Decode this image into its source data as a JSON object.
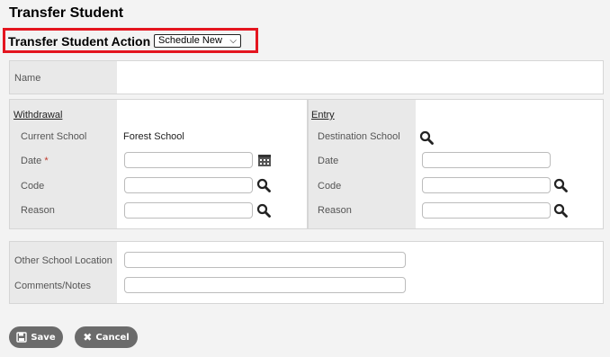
{
  "page": {
    "title": "Transfer Student"
  },
  "action": {
    "label": "Transfer Student Action :",
    "selected": "Schedule New"
  },
  "name_section": {
    "label": "Name"
  },
  "withdrawal": {
    "header": "Withdrawal",
    "current_school_label": "Current School",
    "current_school_value": "Forest School",
    "date_label": "Date",
    "date_required_mark": "*",
    "code_label": "Code",
    "reason_label": "Reason"
  },
  "entry": {
    "header": "Entry",
    "destination_school_label": "Destination School",
    "date_label": "Date",
    "code_label": "Code",
    "reason_label": "Reason"
  },
  "other": {
    "location_label": "Other School Location",
    "comments_label": "Comments/Notes"
  },
  "buttons": {
    "save": "Save",
    "cancel": "Cancel"
  },
  "icons": [
    "search-icon",
    "calendar-icon",
    "save-icon",
    "cancel-icon",
    "chevron-down-icon"
  ]
}
